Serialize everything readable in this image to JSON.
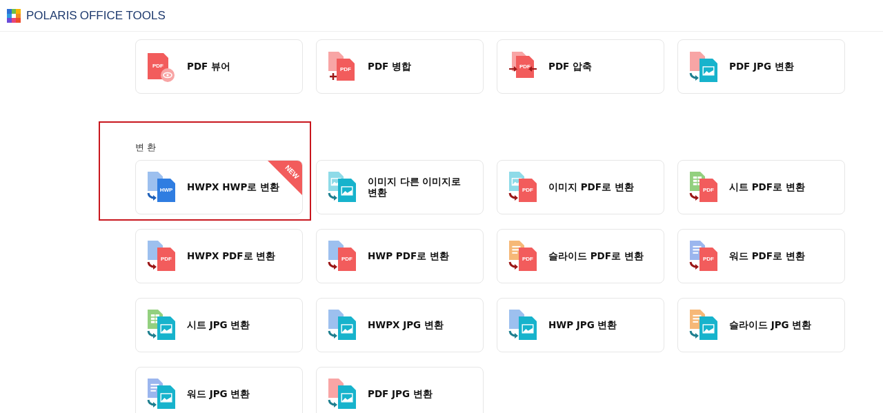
{
  "header": {
    "brand_bold": "POLARIS",
    "brand_light": "OFFICE TOOLS"
  },
  "sections": [
    {
      "tools": [
        {
          "label": "PDF 뷰어",
          "icon": {
            "kind": "view",
            "front": {
              "kind": "pdf",
              "text": "PDF"
            }
          }
        },
        {
          "label": "PDF 병합",
          "icon": {
            "kind": "merge",
            "front": {
              "kind": "pdf",
              "text": "PDF"
            }
          }
        },
        {
          "label": "PDF 압축",
          "icon": {
            "kind": "compress",
            "front": {
              "kind": "pdf",
              "text": "PDF"
            }
          }
        },
        {
          "label": "PDF JPG 변환",
          "icon": {
            "kind": "convert",
            "back": {
              "kind": "pdf"
            },
            "front": {
              "kind": "image"
            }
          }
        }
      ]
    },
    {
      "title": "변 환",
      "highlighted": true,
      "tools": [
        {
          "label": "HWPX HWP로 변환",
          "badge": "NEW",
          "icon": {
            "kind": "convert",
            "back": {
              "kind": "hwpx"
            },
            "front": {
              "kind": "hwp",
              "text": "HWP"
            }
          }
        },
        {
          "label": "이미지 다른 이미지로 변환",
          "icon": {
            "kind": "convert",
            "back": {
              "kind": "image"
            },
            "front": {
              "kind": "image"
            }
          }
        },
        {
          "label": "이미지 PDF로 변환",
          "icon": {
            "kind": "convert",
            "back": {
              "kind": "image"
            },
            "front": {
              "kind": "pdf",
              "text": "PDF"
            }
          }
        },
        {
          "label": "시트 PDF로 변환",
          "icon": {
            "kind": "convert",
            "back": {
              "kind": "sheet"
            },
            "front": {
              "kind": "pdf",
              "text": "PDF"
            }
          }
        },
        {
          "label": "HWPX PDF로 변환",
          "icon": {
            "kind": "convert",
            "back": {
              "kind": "hwpx"
            },
            "front": {
              "kind": "pdf",
              "text": "PDF"
            }
          }
        },
        {
          "label": "HWP PDF로 변환",
          "icon": {
            "kind": "convert",
            "back": {
              "kind": "hwpx"
            },
            "front": {
              "kind": "pdf",
              "text": "PDF"
            }
          }
        },
        {
          "label": "슬라이드 PDF로 변환",
          "icon": {
            "kind": "convert",
            "back": {
              "kind": "slide"
            },
            "front": {
              "kind": "pdf",
              "text": "PDF"
            }
          }
        },
        {
          "label": "워드 PDF로 변환",
          "icon": {
            "kind": "convert",
            "back": {
              "kind": "word"
            },
            "front": {
              "kind": "pdf",
              "text": "PDF"
            }
          }
        },
        {
          "label": "시트 JPG 변환",
          "icon": {
            "kind": "convert",
            "back": {
              "kind": "sheet"
            },
            "front": {
              "kind": "image"
            }
          }
        },
        {
          "label": "HWPX JPG 변환",
          "icon": {
            "kind": "convert",
            "back": {
              "kind": "hwpx"
            },
            "front": {
              "kind": "image"
            }
          }
        },
        {
          "label": "HWP JPG 변환",
          "icon": {
            "kind": "convert",
            "back": {
              "kind": "hwpx"
            },
            "front": {
              "kind": "image"
            }
          }
        },
        {
          "label": "슬라이드 JPG 변환",
          "icon": {
            "kind": "convert",
            "back": {
              "kind": "slide"
            },
            "front": {
              "kind": "image"
            }
          }
        },
        {
          "label": "워드 JPG 변환",
          "icon": {
            "kind": "convert",
            "back": {
              "kind": "word"
            },
            "front": {
              "kind": "image"
            }
          }
        },
        {
          "label": "PDF JPG 변환",
          "icon": {
            "kind": "convert",
            "back": {
              "kind": "pdf"
            },
            "front": {
              "kind": "image"
            }
          }
        }
      ]
    }
  ]
}
